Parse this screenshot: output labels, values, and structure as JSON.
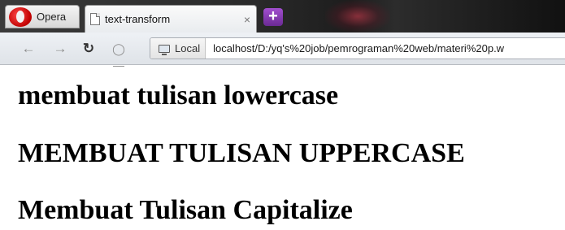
{
  "browser": {
    "menu_label": "Opera",
    "tab": {
      "title": "text-transform",
      "close": "×"
    },
    "new_tab": "+",
    "address": {
      "badge": "Local",
      "url": "localhost/D:/yq's%20job/pemrograman%20web/materi%20p.w"
    }
  },
  "page": {
    "lowercase_text": "membuat tulisan lowercase",
    "uppercase_text": "MEMBUAT TULISAN UPPERCASE",
    "capitalize_text": "Membuat Tulisan Capitalize"
  }
}
